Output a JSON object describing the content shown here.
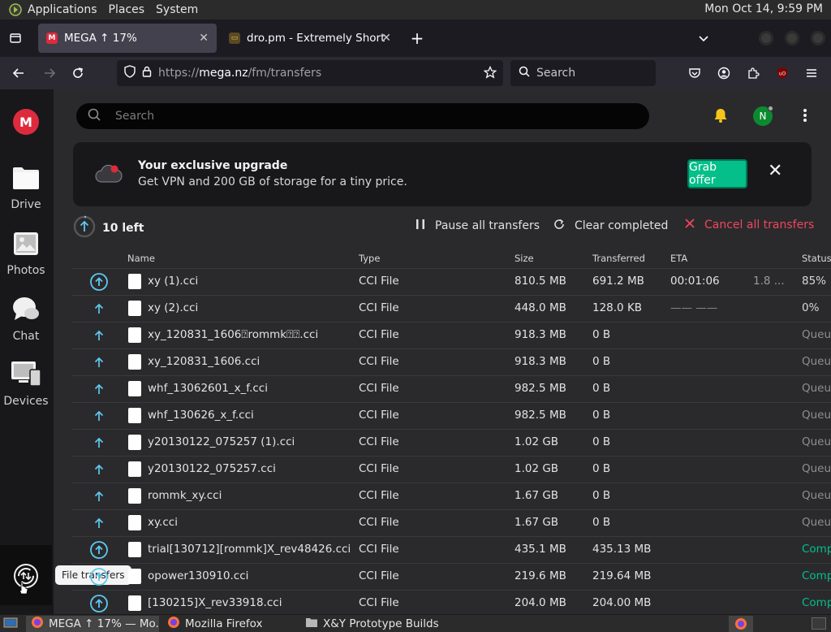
{
  "panel": {
    "menus": [
      "Applications",
      "Places",
      "System"
    ],
    "clock": "Mon Oct 14,  9:59 PM"
  },
  "browser": {
    "tabs": [
      {
        "label": "MEGA ↑ 17%",
        "active": true
      },
      {
        "label": "dro.pm - Extremely Short Li",
        "active": false
      }
    ],
    "url_scheme": "https://",
    "url_host": "mega.nz",
    "url_path": "/fm/transfers",
    "search_placeholder": "Search"
  },
  "sidebar": {
    "items": [
      {
        "label": "Drive",
        "icon": "folder-icon"
      },
      {
        "label": "Photos",
        "icon": "photos-icon"
      },
      {
        "label": "Chat",
        "icon": "chat-icon"
      },
      {
        "label": "Devices",
        "icon": "devices-icon"
      }
    ],
    "tooltip": "File transfers"
  },
  "header": {
    "search_placeholder": "Search",
    "avatar_initial": "N"
  },
  "promo": {
    "title": "Your exclusive upgrade",
    "description": "Get VPN and 200 GB of storage for a tiny price.",
    "button": "Grab offer"
  },
  "transfers": {
    "remaining": "10 left",
    "actions": {
      "pause": "Pause all transfers",
      "clear": "Clear completed",
      "cancel": "Cancel all transfers"
    },
    "columns": [
      "Name",
      "Type",
      "Size",
      "Transferred",
      "ETA",
      "Status"
    ],
    "rows": [
      {
        "name": "xy (1).cci",
        "type": "CCI File",
        "size": "810.5 MB",
        "transferred": "691.2 MB",
        "eta": "00:01:06",
        "speed": "1.8 ...",
        "status": "85%",
        "state": "active",
        "icon": "circle"
      },
      {
        "name": "xy (2).cci",
        "type": "CCI File",
        "size": "448.0 MB",
        "transferred": "128.0 KB",
        "eta": "—— ——",
        "speed": "",
        "status": "0%",
        "state": "active",
        "icon": "arrow"
      },
      {
        "name": "xy_120831_1606⍰rommk⍰⍰.cci",
        "type": "CCI File",
        "size": "918.3 MB",
        "transferred": "0 B",
        "eta": "",
        "speed": "",
        "status": "Queu",
        "state": "queued",
        "icon": "arrow"
      },
      {
        "name": "xy_120831_1606.cci",
        "type": "CCI File",
        "size": "918.3 MB",
        "transferred": "0 B",
        "eta": "",
        "speed": "",
        "status": "Queu",
        "state": "queued",
        "icon": "arrow"
      },
      {
        "name": "whf_13062601_x_f.cci",
        "type": "CCI File",
        "size": "982.5 MB",
        "transferred": "0 B",
        "eta": "",
        "speed": "",
        "status": "Queu",
        "state": "queued",
        "icon": "arrow"
      },
      {
        "name": "whf_130626_x_f.cci",
        "type": "CCI File",
        "size": "982.5 MB",
        "transferred": "0 B",
        "eta": "",
        "speed": "",
        "status": "Queu",
        "state": "queued",
        "icon": "arrow"
      },
      {
        "name": "y20130122_075257 (1).cci",
        "type": "CCI File",
        "size": "1.02 GB",
        "transferred": "0 B",
        "eta": "",
        "speed": "",
        "status": "Queu",
        "state": "queued",
        "icon": "arrow"
      },
      {
        "name": "y20130122_075257.cci",
        "type": "CCI File",
        "size": "1.02 GB",
        "transferred": "0 B",
        "eta": "",
        "speed": "",
        "status": "Queu",
        "state": "queued",
        "icon": "arrow"
      },
      {
        "name": "rommk_xy.cci",
        "type": "CCI File",
        "size": "1.67 GB",
        "transferred": "0 B",
        "eta": "",
        "speed": "",
        "status": "Queu",
        "state": "queued",
        "icon": "arrow"
      },
      {
        "name": "xy.cci",
        "type": "CCI File",
        "size": "1.67 GB",
        "transferred": "0 B",
        "eta": "",
        "speed": "",
        "status": "Queu",
        "state": "queued",
        "icon": "arrow"
      },
      {
        "name": "trial[130712][rommk]X_rev48426.cci",
        "type": "CCI File",
        "size": "435.1 MB",
        "transferred": "435.13 MB",
        "eta": "",
        "speed": "",
        "status": "Comp",
        "state": "completed",
        "icon": "circle"
      },
      {
        "name": "opower130910.cci",
        "type": "CCI File",
        "size": "219.6 MB",
        "transferred": "219.64 MB",
        "eta": "",
        "speed": "",
        "status": "Comp",
        "state": "completed",
        "icon": "circle"
      },
      {
        "name": "[130215]X_rev33918.cci",
        "type": "CCI File",
        "size": "204.0 MB",
        "transferred": "204.00 MB",
        "eta": "",
        "speed": "",
        "status": "Comp",
        "state": "completed",
        "icon": "circle"
      }
    ]
  },
  "taskbar": {
    "items": [
      {
        "label": "MEGA ↑ 17% — Mo...",
        "active": true
      },
      {
        "label": "Mozilla Firefox",
        "active": false
      },
      {
        "label": "X&Y Prototype Builds",
        "active": false
      }
    ]
  },
  "colors": {
    "mega_red": "#dd2b3d",
    "accent_green": "#04bf8a",
    "cancel_red": "#f0465c",
    "upload_blue": "#5ec8f0"
  }
}
